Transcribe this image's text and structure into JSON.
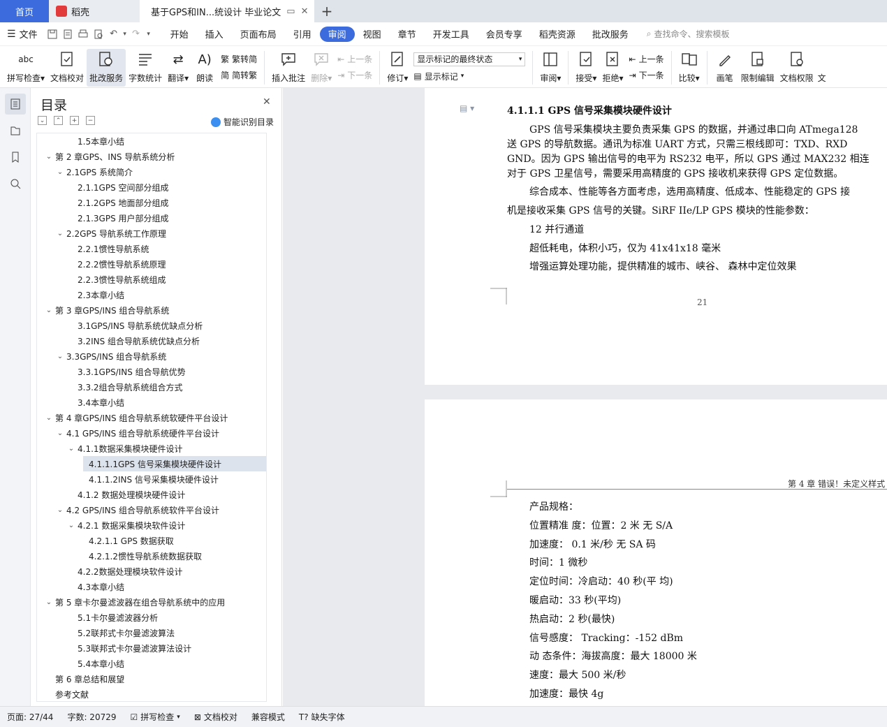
{
  "tabs": {
    "home": "首页",
    "doc1": "稻壳",
    "doc2": "基于GPS和IN...统设计 毕业论文"
  },
  "menu": {
    "file": "文件",
    "items": [
      "开始",
      "插入",
      "页面布局",
      "引用",
      "审阅",
      "视图",
      "章节",
      "开发工具",
      "会员专享",
      "稻壳资源",
      "批改服务"
    ],
    "active": "审阅",
    "search": "查找命令、搜索模板"
  },
  "ribbon": {
    "spell": "拼写检查",
    "proof": "文档校对",
    "correct": "批改服务",
    "wordcount": "字数统计",
    "translate": "翻译",
    "read": "朗读",
    "to_trad": "繁转简",
    "to_simp": "简转繁",
    "insert_comment": "插入批注",
    "delete": "删除",
    "prev": "上一条",
    "next": "下一条",
    "revise": "修订",
    "markup_state": "显示标记的最终状态",
    "show_markup": "显示标记",
    "review": "审阅",
    "accept": "接受",
    "reject": "拒绝",
    "prev2": "上一条",
    "next2": "下一条",
    "compare": "比较",
    "pen": "画笔",
    "restrict": "限制编辑",
    "rights": "文档权限",
    "more": "文"
  },
  "toc": {
    "title": "目录",
    "smart": "智能识别目录",
    "items": [
      {
        "text": "1.5本章小结",
        "level": 2,
        "chev": ""
      },
      {
        "text": "第 2 章GPS、INS 导航系统分析",
        "level": 0,
        "chev": "v"
      },
      {
        "text": "2.1GPS 系统简介",
        "level": 1,
        "chev": "v"
      },
      {
        "text": "2.1.1GPS 空间部分组成",
        "level": 3,
        "chev": ""
      },
      {
        "text": "2.1.2GPS 地面部分组成",
        "level": 3,
        "chev": ""
      },
      {
        "text": "2.1.3GPS 用户部分组成",
        "level": 3,
        "chev": ""
      },
      {
        "text": "2.2GPS 导航系统工作原理",
        "level": 1,
        "chev": "v"
      },
      {
        "text": "2.2.1惯性导航系统",
        "level": 3,
        "chev": ""
      },
      {
        "text": "2.2.2惯性导航系统原理",
        "level": 3,
        "chev": ""
      },
      {
        "text": "2.2.3惯性导航系统组成",
        "level": 3,
        "chev": ""
      },
      {
        "text": "2.3本章小结",
        "level": 2,
        "chev": ""
      },
      {
        "text": "第 3 章GPS/INS 组合导航系统",
        "level": 0,
        "chev": "v"
      },
      {
        "text": "3.1GPS/INS 导航系统优缺点分析",
        "level": 2,
        "chev": ""
      },
      {
        "text": "3.2INS 组合导航系统优缺点分析",
        "level": 2,
        "chev": ""
      },
      {
        "text": "3.3GPS/INS 组合导航系统",
        "level": 1,
        "chev": "v"
      },
      {
        "text": "3.3.1GPS/INS 组合导航优势",
        "level": 3,
        "chev": ""
      },
      {
        "text": "3.3.2组合导航系统组合方式",
        "level": 3,
        "chev": ""
      },
      {
        "text": "3.4本章小结",
        "level": 2,
        "chev": ""
      },
      {
        "text": "第 4 章GPS/INS 组合导航系统软硬件平台设计",
        "level": 0,
        "chev": "v"
      },
      {
        "text": "4.1  GPS/INS 组合导航系统硬件平台设计",
        "level": 1,
        "chev": "v"
      },
      {
        "text": "4.1.1数据采集模块硬件设计",
        "level": 2,
        "chev": "v"
      },
      {
        "text": "4.1.1.1GPS 信号采集模块硬件设计",
        "level": 4,
        "chev": "",
        "selected": true
      },
      {
        "text": "4.1.1.2INS 信号采集模块硬件设计",
        "level": 4,
        "chev": ""
      },
      {
        "text": "4.1.2  数据处理模块硬件设计",
        "level": 3,
        "chev": ""
      },
      {
        "text": "4.2  GPS/INS 组合导航系统软件平台设计",
        "level": 1,
        "chev": "v"
      },
      {
        "text": "4.2.1  数据采集模块软件设计",
        "level": 2,
        "chev": "v"
      },
      {
        "text": "4.2.1.1  GPS 数据获取",
        "level": 4,
        "chev": ""
      },
      {
        "text": "4.2.1.2惯性导航系统数据获取",
        "level": 4,
        "chev": ""
      },
      {
        "text": "4.2.2数据处理模块软件设计",
        "level": 3,
        "chev": ""
      },
      {
        "text": "4.3本章小结",
        "level": 2,
        "chev": ""
      },
      {
        "text": "第 5 章卡尔曼滤波器在组合导航系统中的应用",
        "level": 0,
        "chev": "v"
      },
      {
        "text": "5.1卡尔曼滤波器分析",
        "level": 2,
        "chev": ""
      },
      {
        "text": "5.2联邦式卡尔曼滤波算法",
        "level": 2,
        "chev": ""
      },
      {
        "text": "5.3联邦式卡尔曼滤波算法设计",
        "level": 2,
        "chev": ""
      },
      {
        "text": "5.4本章小结",
        "level": 2,
        "chev": ""
      },
      {
        "text": "第 6 章总结和展望",
        "level": 0,
        "chev": ""
      },
      {
        "text": "参考文献",
        "level": 0,
        "chev": ""
      }
    ]
  },
  "page1": {
    "heading": "4.1.1.1  GPS 信号采集模块硬件设计",
    "lines": [
      "GPS 信号采集模块主要负责采集 GPS 的数据，并通过串口向 ATmega128",
      "送 GPS 的导航数据。通讯为标准 UART 方式，只需三根线即可：TXD、RXD",
      "GND。因为 GPS 输出信号的电平为 RS232 电平，所以 GPS 通过 MAX232 相连",
      "对于 GPS 卫星信号，需要采用高精度的 GPS 接收机来获得 GPS 定位数据。",
      "综合成本、性能等各方面考虑，选用高精度、低成本、性能稳定的 GPS 接",
      "机是接收采集 GPS 信号的关键。SiRF IIe/LP GPS 模块的性能参数：",
      "12 并行通道",
      "超低耗电，体积小巧，仅为 41x41x18 毫米",
      "增强运算处理功能，提供精准的城市、峡谷、 森林中定位效果"
    ],
    "page_number": "21"
  },
  "page2": {
    "header": "第 4 章  错误！未定义样式",
    "lines": [
      "产品规格：",
      "位置精准 度：位置：2 米  无 S/A",
      "加速度：  0.1 米/秒  无 SA 码",
      "时间：1  微秒",
      "定位时间：冷启动：40 秒(平  均)",
      "暖启动：33 秒(平均)",
      "热启动：2  秒(最快)",
      "信号感度：  Tracking：-152  dBm",
      "动  态条件：海拔高度：最大  18000 米",
      "速度：最大 500 米/秒",
      "加速度：最快 4g"
    ]
  },
  "status": {
    "page": "页面: 27/44",
    "words": "字数: 20729",
    "spell": "拼写检查",
    "proof": "文档校对",
    "compat": "兼容模式",
    "missing_font": "缺失字体"
  },
  "colors": {
    "accent": "#3b6bdc",
    "tabbar": "#dfe3ea",
    "canvas": "#e8eaee"
  }
}
